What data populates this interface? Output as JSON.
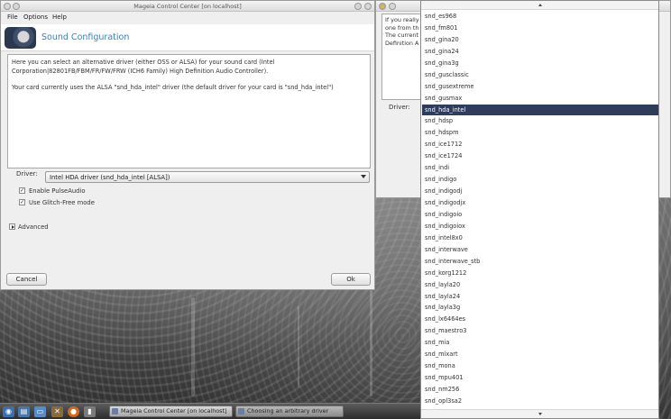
{
  "main_window": {
    "title": "Mageia Control Center  [on localhost]",
    "menu": [
      "File",
      "Options",
      "Help"
    ],
    "header_title": "Sound Configuration",
    "description": [
      "Here you can select an alternative driver (either OSS or ALSA) for your sound card (Intel Corporation|82801FB/FBM/FR/FW/FRW (ICH6 Family) High Definition Audio Controller).",
      "Your card currently uses the ALSA \"snd_hda_intel\" driver (the default driver for your card is \"snd_hda_intel\")"
    ],
    "driver_label": "Driver:",
    "driver_value": "Intel HDA driver (snd_hda_intel [ALSA])",
    "checkboxes": [
      {
        "label": "Enable PulseAudio",
        "checked": true
      },
      {
        "label": "Use Glitch-Free mode",
        "checked": true
      }
    ],
    "advanced_label": "Advanced",
    "cancel_label": "Cancel",
    "ok_label": "Ok"
  },
  "second_window": {
    "text_lines": [
      "If you really",
      "one from th",
      "The current",
      "Definition A"
    ],
    "driver_label": "Driver:"
  },
  "driver_list": {
    "selected": "snd_hda_intel",
    "items": [
      "snd_es968",
      "snd_fm801",
      "snd_gina20",
      "snd_gina24",
      "snd_gina3g",
      "snd_gusclassic",
      "snd_gusextreme",
      "snd_gusmax",
      "snd_hda_intel",
      "snd_hdsp",
      "snd_hdspm",
      "snd_ice1712",
      "snd_ice1724",
      "snd_indi",
      "snd_indigo",
      "snd_indigodj",
      "snd_indigodjx",
      "snd_indigoio",
      "snd_indigoiox",
      "snd_intel8x0",
      "snd_interwave",
      "snd_interwave_stb",
      "snd_korg1212",
      "snd_layla20",
      "snd_layla24",
      "snd_layla3g",
      "snd_lx6464es",
      "snd_maestro3",
      "snd_mia",
      "snd_mixart",
      "snd_mona",
      "snd_mpu401",
      "snd_nm256",
      "snd_opl3sa2"
    ]
  },
  "taskbar": {
    "tasks": [
      "Mageia Control Center  [on localhost]",
      "Choosing an arbitrary driver"
    ]
  }
}
